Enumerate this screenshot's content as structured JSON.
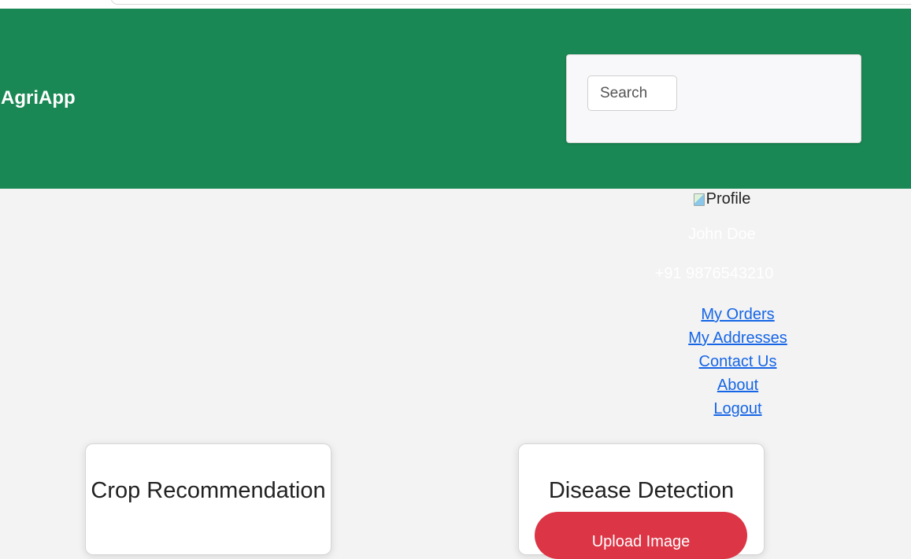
{
  "app": {
    "brand": "AgriApp"
  },
  "search": {
    "placeholder": "Search"
  },
  "profile": {
    "image_alt": "Profile",
    "name": "John Doe",
    "phone": "+91 9876543210"
  },
  "menu": {
    "items": [
      {
        "label": "My Orders"
      },
      {
        "label": "My Addresses"
      },
      {
        "label": "Contact Us"
      },
      {
        "label": "About"
      },
      {
        "label": "Logout"
      }
    ]
  },
  "cards": [
    {
      "title": "Crop Recommendation"
    },
    {
      "title": "Disease Detection",
      "button_label": "Upload Image"
    }
  ],
  "colors": {
    "header": "#1a8854",
    "link": "#1565e6",
    "upload_button": "#dc3545",
    "page_background": "#f3f3f3"
  }
}
